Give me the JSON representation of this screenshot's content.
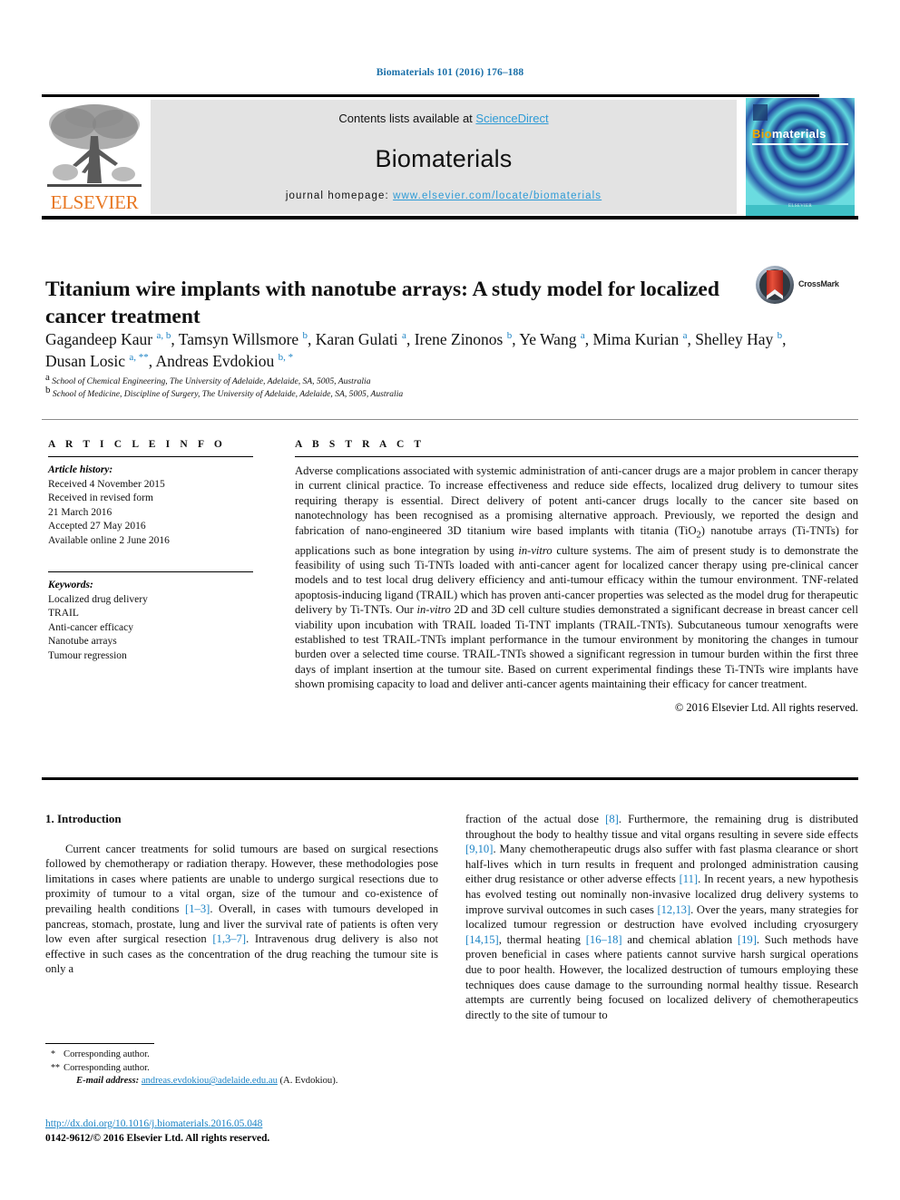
{
  "running_head": "Biomaterials 101 (2016) 176–188",
  "masthead": {
    "contents_prefix": "Contents lists available at ",
    "contents_link": "ScienceDirect",
    "journal_title": "Biomaterials",
    "homepage_prefix": "journal homepage: ",
    "homepage_link": "www.elsevier.com/locate/biomaterials",
    "publisher_wordmark": "ELSEVIER",
    "publisher_logo_icon": "elsevier-tree-icon",
    "cover": {
      "title_part1": "Bio",
      "title_part2": "materials",
      "footer": "ELSEVIER"
    }
  },
  "article": {
    "title": "Titanium wire implants with nanotube arrays: A study model for localized cancer treatment",
    "crossmark_label": "CrossMark",
    "authors_html": "Gagandeep Kaur <sup>a, b</sup>, Tamsyn Willsmore <sup>b</sup>, Karan Gulati <sup>a</sup>, Irene Zinonos <sup>b</sup>, Ye Wang <sup>a</sup>, Mima Kurian <sup>a</sup>, Shelley Hay <sup>b</sup>, Dusan Losic <sup>a, **</sup>, Andreas Evdokiou <sup>b, *</sup>",
    "affiliations": [
      {
        "marker": "a",
        "text": "School of Chemical Engineering, The University of Adelaide, Adelaide, SA, 5005, Australia"
      },
      {
        "marker": "b",
        "text": "School of Medicine, Discipline of Surgery, The University of Adelaide, Adelaide, SA, 5005, Australia"
      }
    ]
  },
  "article_info": {
    "heading": "A R T I C L E   I N F O",
    "history_label": "Article history:",
    "history": [
      "Received 4 November 2015",
      "Received in revised form",
      "21 March 2016",
      "Accepted 27 May 2016",
      "Available online 2 June 2016"
    ],
    "keywords_label": "Keywords:",
    "keywords": [
      "Localized drug delivery",
      "TRAIL",
      "Anti-cancer efficacy",
      "Nanotube arrays",
      "Tumour regression"
    ]
  },
  "abstract": {
    "heading": "A B S T R A C T",
    "body_html": "Adverse complications associated with systemic administration of anti-cancer drugs are a major problem in cancer therapy in current clinical practice. To increase effectiveness and reduce side effects, localized drug delivery to tumour sites requiring therapy is essential. Direct delivery of potent anti-cancer drugs locally to the cancer site based on nanotechnology has been recognised as a promising alternative approach. Previously, we reported the design and fabrication of nano-engineered 3D titanium wire based implants with titania (TiO<sub>2</sub>) nanotube arrays (Ti-TNTs) for applications such as bone integration by using <i>in-vitro</i> culture systems. The aim of present study is to demonstrate the feasibility of using such Ti-TNTs loaded with anti-cancer agent for localized cancer therapy using pre-clinical cancer models and to test local drug delivery efficiency and anti-tumour efficacy within the tumour environment. TNF-related apoptosis-inducing ligand (TRAIL) which has proven anti-cancer properties was selected as the model drug for therapeutic delivery by Ti-TNTs. Our <i>in-vitro</i> 2D and 3D cell culture studies demonstrated a significant decrease in breast cancer cell viability upon incubation with TRAIL loaded Ti-TNT implants (TRAIL-TNTs). Subcutaneous tumour xenografts were established to test TRAIL-TNTs implant performance in the tumour environment by monitoring the changes in tumour burden over a selected time course. TRAIL-TNTs showed a significant regression in tumour burden within the first three days of implant insertion at the tumour site. Based on current experimental findings these Ti-TNTs wire implants have shown promising capacity to load and deliver anti-cancer agents maintaining their efficacy for cancer treatment.",
    "copyright": "© 2016 Elsevier Ltd. All rights reserved."
  },
  "introduction": {
    "heading": "1. Introduction",
    "left_column_html": "Current cancer treatments for solid tumours are based on surgical resections followed by chemotherapy or radiation therapy. However, these methodologies pose limitations in cases where patients are unable to undergo surgical resections due to proximity of tumour to a vital organ, size of the tumour and co-existence of prevailing health conditions <span class=\"ref\">[1&#8211;3]</span>. Overall, in cases with tumours developed in pancreas, stomach, prostate, lung and liver the survival rate of patients is often very low even after surgical resection <span class=\"ref\">[1,3&#8211;7]</span>. Intravenous drug delivery is also not effective in such cases as the concentration of the drug reaching the tumour site is only a",
    "right_column_html": "fraction of the actual dose <span class=\"ref\">[8]</span>. Furthermore, the remaining drug is distributed throughout the body to healthy tissue and vital organs resulting in severe side effects <span class=\"ref\">[9,10]</span>. Many chemotherapeutic drugs also suffer with fast plasma clearance or short half-lives which in turn results in frequent and prolonged administration causing either drug resistance or other adverse effects <span class=\"ref\">[11]</span>. In recent years, a new hypothesis has evolved testing out nominally non-invasive localized drug delivery systems to improve survival outcomes in such cases <span class=\"ref\">[12,13]</span>. Over the years, many strategies for localized tumour regression or destruction have evolved including cryosurgery <span class=\"ref\">[14,15]</span>, thermal heating <span class=\"ref\">[16&#8211;18]</span> and chemical ablation <span class=\"ref\">[19]</span>. Such methods have proven beneficial in cases where patients cannot survive harsh surgical operations due to poor health. However, the localized destruction of tumours employing these techniques does cause damage to the surrounding normal healthy tissue. Research attempts are currently being focused on localized delivery of chemotherapeutics directly to the site of tumour to"
  },
  "footnotes": {
    "corresponding_1_mark": "*",
    "corresponding_1": "Corresponding author.",
    "corresponding_2_mark": "**",
    "corresponding_2": "Corresponding author.",
    "email_label": "E-mail address:",
    "email_link": "andreas.evdokiou@adelaide.edu.au",
    "email_suffix": "(A. Evdokiou)."
  },
  "footer": {
    "doi": "http://dx.doi.org/10.1016/j.biomaterials.2016.05.048",
    "issn_line": "0142-9612/© 2016 Elsevier Ltd. All rights reserved."
  },
  "colors": {
    "link_blue": "#1a82c4",
    "elsevier_orange": "#E87722",
    "cover_teal": "#2aa8b0",
    "sciencedirect_blue": "#2e9bd6"
  }
}
